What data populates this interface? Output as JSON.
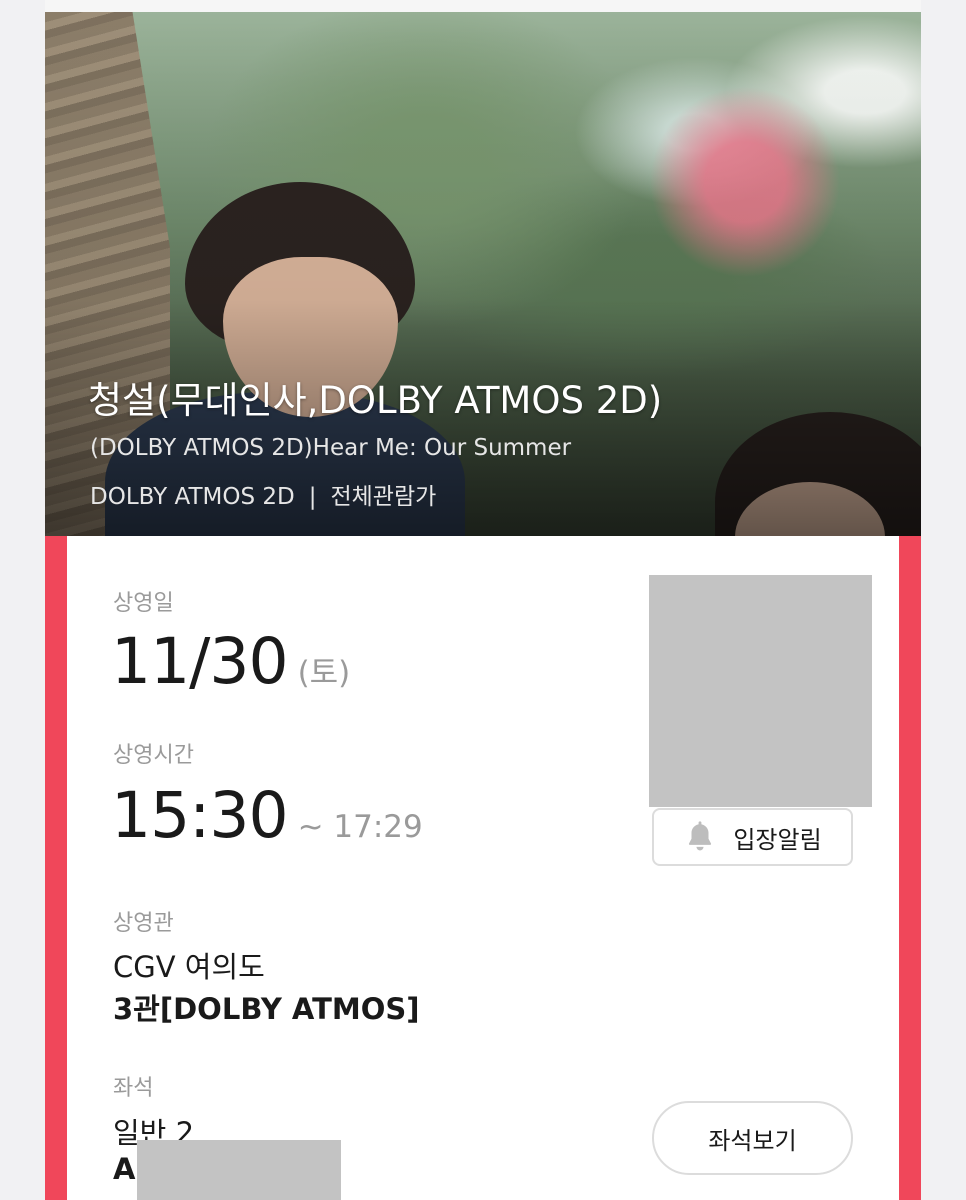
{
  "movie": {
    "title": "청설(무대인사,DOLBY ATMOS 2D)",
    "subtitle": "(DOLBY ATMOS 2D)Hear Me: Our Summer",
    "format": "DOLBY ATMOS 2D",
    "separator": "|",
    "rating": "전체관람가"
  },
  "screening": {
    "date_label": "상영일",
    "date": "11/30",
    "weekday": "(토)",
    "time_label": "상영시간",
    "start_time": "15:30",
    "end_time": "~ 17:29",
    "theater_label": "상영관",
    "cinema": "CGV 여의도",
    "hall": "3관[DOLBY ATMOS]",
    "seat_label": "좌석",
    "seat_type": "일반 2",
    "seat_row": "A"
  },
  "buttons": {
    "alarm": "입장알림",
    "seat_view": "좌석보기"
  },
  "icons": {
    "alarm_icon": "bell-icon"
  },
  "colors": {
    "accent": "#f0475a"
  }
}
